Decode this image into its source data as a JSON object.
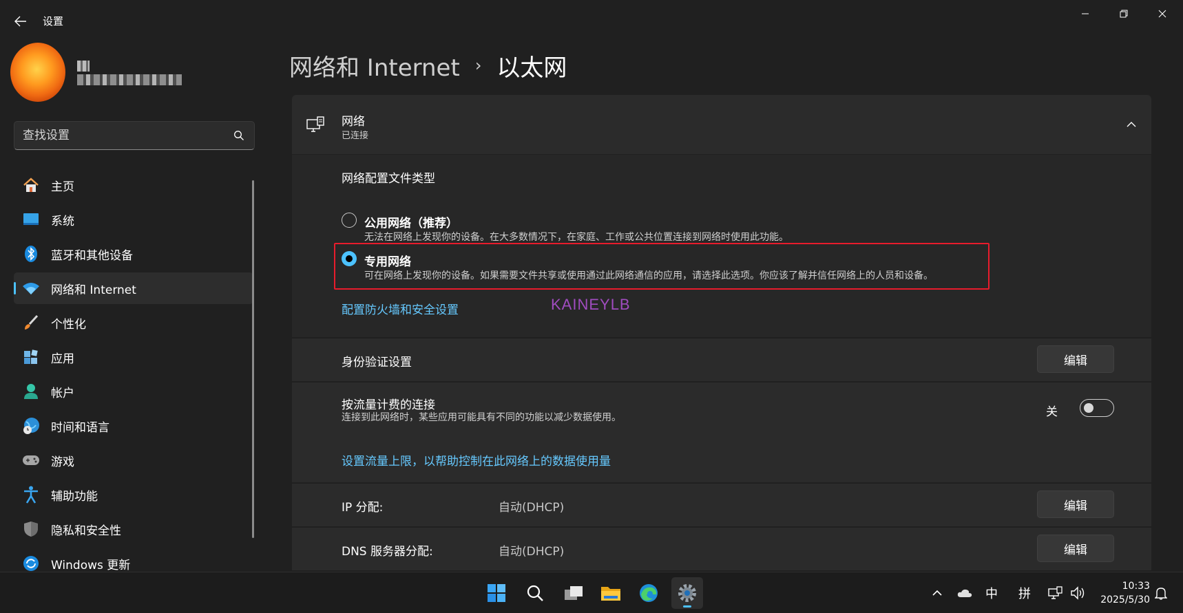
{
  "window": {
    "title": "设置"
  },
  "sidebar": {
    "search_placeholder": "查找设置",
    "items": [
      {
        "label": "主页",
        "icon": "home-icon"
      },
      {
        "label": "系统",
        "icon": "system-icon"
      },
      {
        "label": "蓝牙和其他设备",
        "icon": "bluetooth-icon"
      },
      {
        "label": "网络和 Internet",
        "icon": "wifi-icon",
        "active": true
      },
      {
        "label": "个性化",
        "icon": "brush-icon"
      },
      {
        "label": "应用",
        "icon": "apps-icon"
      },
      {
        "label": "帐户",
        "icon": "account-icon"
      },
      {
        "label": "时间和语言",
        "icon": "globe-clock-icon"
      },
      {
        "label": "游戏",
        "icon": "gamepad-icon"
      },
      {
        "label": "辅助功能",
        "icon": "accessibility-icon"
      },
      {
        "label": "隐私和安全性",
        "icon": "shield-icon"
      },
      {
        "label": "Windows 更新",
        "icon": "update-icon"
      }
    ]
  },
  "header": {
    "parent": "网络和 Internet",
    "separator": "›",
    "current": "以太网"
  },
  "network": {
    "title": "网络",
    "status": "已连接",
    "profile_section_title": "网络配置文件类型",
    "options": [
      {
        "label": "公用网络（推荐）",
        "desc": "无法在网络上发现你的设备。在大多数情况下，在家庭、工作或公共位置连接到网络时使用此功能。",
        "selected": false
      },
      {
        "label": "专用网络",
        "desc": "可在网络上发现你的设备。如果需要文件共享或使用通过此网络通信的应用，请选择此选项。你应该了解并信任网络上的人员和设备。",
        "selected": true
      }
    ],
    "firewall_link": "配置防火墙和安全设置",
    "watermark": "KAINEYLB"
  },
  "auth": {
    "title": "身份验证设置",
    "button": "编辑"
  },
  "metered": {
    "title": "按流量计费的连接",
    "desc": "连接到此网络时，某些应用可能具有不同的功能以减少数据使用。",
    "toggle_label": "关",
    "toggle_on": false,
    "link": "设置流量上限，以帮助控制在此网络上的数据使用量"
  },
  "ip": {
    "title": "IP 分配:",
    "value": "自动(DHCP)",
    "button": "编辑"
  },
  "dns": {
    "title": "DNS 服务器分配:",
    "value": "自动(DHCP)",
    "button": "编辑"
  },
  "taskbar": {
    "tray_ime_lang": "中",
    "tray_ime_mode": "拼",
    "time": "10:33",
    "date": "2025/5/30"
  },
  "colors": {
    "accent": "#4cc2ff",
    "link": "#66c9ff",
    "highlight_box": "#e81c2c",
    "watermark": "#a04cc0",
    "background": "#202020"
  }
}
